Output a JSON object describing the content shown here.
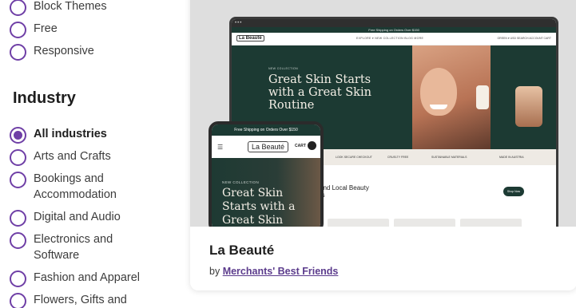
{
  "sidebar": {
    "top_options": [
      "Block Themes",
      "Free",
      "Responsive"
    ],
    "industry_heading": "Industry",
    "industries": [
      "All industries",
      "Arts and Crafts",
      "Bookings and Accommodation",
      "Digital and Audio",
      "Electronics and Software",
      "Fashion and Apparel",
      "Flowers, Gifts and"
    ],
    "selected_industry": "All industries"
  },
  "card": {
    "title": "La Beauté",
    "by_prefix": "by",
    "author": "Merchants' Best Friends"
  },
  "preview": {
    "desktop": {
      "shipping_bar": "Free Shipping on Orders Over $150",
      "logo": "La Beauté",
      "nav_links": "EXPLORE ▾   NEW COLLECTION   BLOG   MORE",
      "nav_right": "GREEN ▾ USD   SEARCH   ACCOUNT   CART",
      "hero_tag": "NEW COLLECTION",
      "hero_title": "Great Skin Starts with a Great Skin Routine",
      "strip_items": [
        "LOOK SECURE CHECKOUT",
        "CRUELTY FREE",
        "SUSTAINABLE MATERIALS",
        "MADE IN AUSTRIA"
      ],
      "lower_text": "and Local Beauty\nrs",
      "lower_button": "Shop Now"
    },
    "phone": {
      "shipping_bar": "Free Shipping on Orders Over $150",
      "logo": "La Beauté",
      "cart_label": "CART",
      "hero_tag": "NEW COLLECTION",
      "hero_title": "Great Skin Starts with a Great Skin"
    }
  },
  "colors": {
    "accent": "#6f3fa6",
    "brand_dark_green": "#1c3a33",
    "link": "#5b3b8c"
  }
}
